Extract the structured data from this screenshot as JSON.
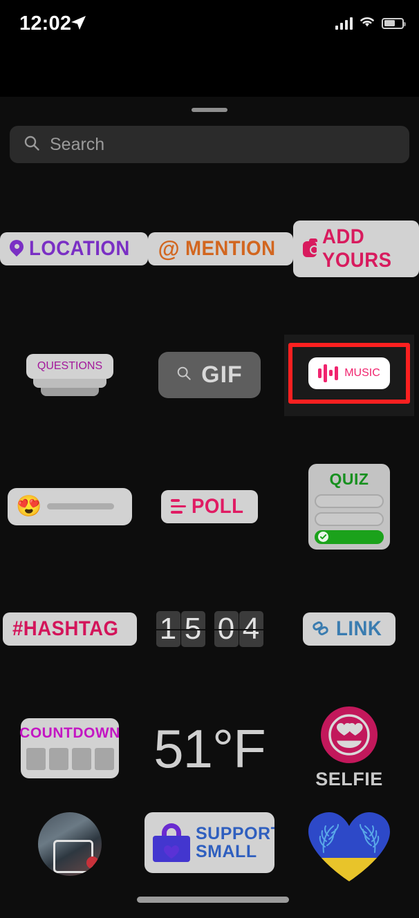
{
  "status_bar": {
    "time": "12:02",
    "location_icon": "location-arrow-icon",
    "signal_icon": "cellular-bars-icon",
    "wifi_icon": "wifi-icon",
    "battery_icon": "battery-icon"
  },
  "sheet": {
    "grabber": "sheet-grabber",
    "search": {
      "placeholder": "Search",
      "value": "",
      "icon": "search-icon"
    }
  },
  "stickers": {
    "rows": [
      {
        "items": [
          {
            "id": "location",
            "label": "LOCATION",
            "icon": "location-pin-icon",
            "color": "#7a2fc4"
          },
          {
            "id": "mention",
            "label": "MENTION",
            "icon": "at-sign-icon",
            "glyph": "@",
            "color": "#d2661f"
          },
          {
            "id": "add-yours",
            "label": "ADD YOURS",
            "icon": "camera-icon",
            "color": "#d81b5e"
          }
        ]
      },
      {
        "items": [
          {
            "id": "questions",
            "label": "QUESTIONS",
            "color": "#a3189b"
          },
          {
            "id": "gif",
            "label": "GIF",
            "icon": "search-icon",
            "color": "#d8d8d8"
          },
          {
            "id": "music",
            "label": "MUSIC",
            "icon": "equalizer-icon",
            "color": "#f0246e",
            "selected": true,
            "selection_color": "#fc2020"
          }
        ]
      },
      {
        "items": [
          {
            "id": "emoji-slider",
            "emoji": "😍",
            "label": ""
          },
          {
            "id": "poll",
            "label": "POLL",
            "icon": "poll-bars-icon",
            "color": "#e01b63"
          },
          {
            "id": "quiz",
            "label": "QUIZ",
            "color": "#17901f",
            "options": [
              "",
              "",
              ""
            ],
            "correct_index": 2
          }
        ]
      },
      {
        "items": [
          {
            "id": "hashtag",
            "label": "#HASHTAG",
            "color": "#d3145a"
          },
          {
            "id": "countdown-clock",
            "digits": [
              "1",
              "5",
              "0",
              "4"
            ]
          },
          {
            "id": "link",
            "label": "LINK",
            "icon": "chain-link-icon",
            "color": "#3a7cb0"
          }
        ]
      },
      {
        "items": [
          {
            "id": "countdown",
            "label": "COUNTDOWN",
            "color": "#c316c3",
            "blocks": 4
          },
          {
            "id": "temperature",
            "label": "51°F",
            "color": "#cfcfcf"
          },
          {
            "id": "selfie",
            "label": "SELFIE",
            "color": "#c2185b",
            "icon": "heart-eyes-face-icon"
          }
        ]
      },
      {
        "items": [
          {
            "id": "photo-sticker",
            "label": ""
          },
          {
            "id": "support-small-business",
            "line1": "SUPPORT",
            "line2": "SMALL",
            "icon": "shopping-bag-heart-icon"
          },
          {
            "id": "ukraine-heart",
            "label": ""
          }
        ]
      }
    ]
  }
}
